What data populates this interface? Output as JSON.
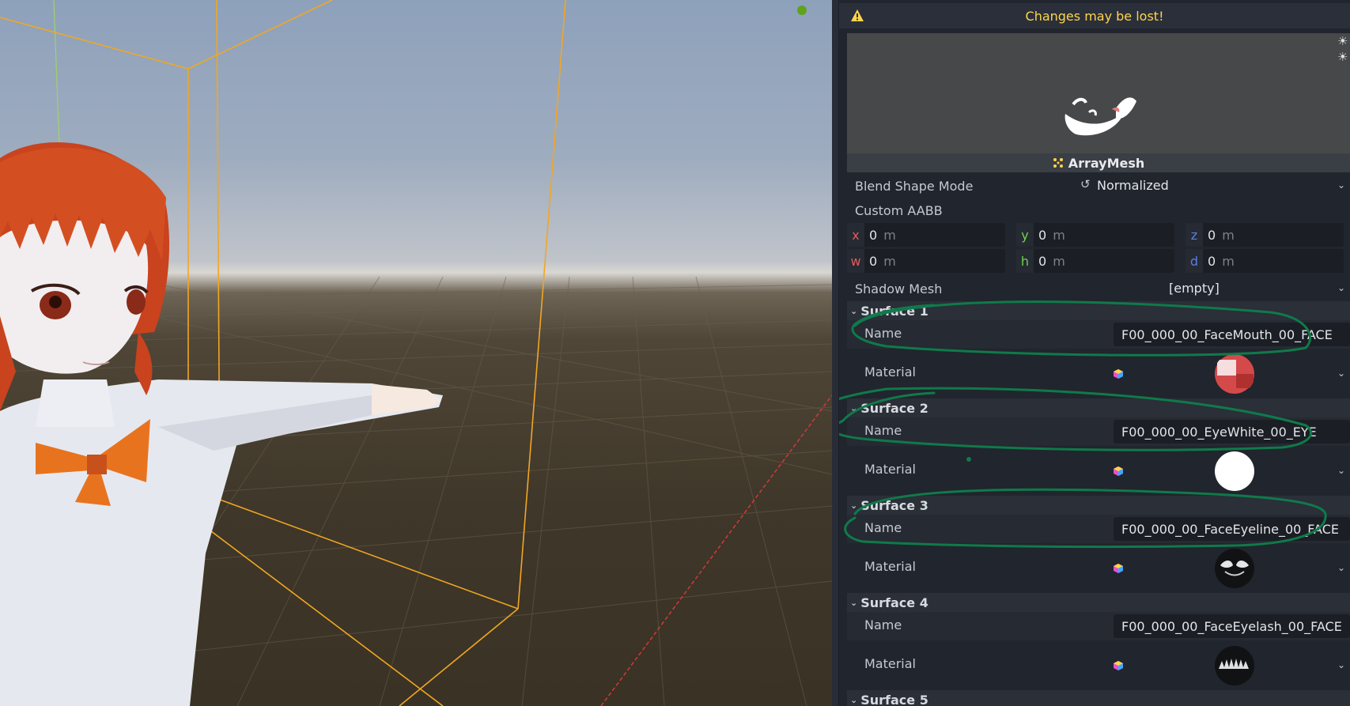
{
  "warning": {
    "text": "Changes may be lost!"
  },
  "mesh_resource": {
    "type_label": "ArrayMesh"
  },
  "properties": {
    "blend_shape_mode": {
      "label": "Blend Shape Mode",
      "value": "Normalized"
    },
    "custom_aabb": {
      "label": "Custom AABB",
      "fields": [
        {
          "axis": "x",
          "value": "0",
          "unit": "m",
          "color": "#e05c5c"
        },
        {
          "axis": "y",
          "value": "0",
          "unit": "m",
          "color": "#6fd14f"
        },
        {
          "axis": "z",
          "value": "0",
          "unit": "m",
          "color": "#5b7fe0"
        },
        {
          "axis": "w",
          "value": "0",
          "unit": "m",
          "color": "#e05c5c"
        },
        {
          "axis": "h",
          "value": "0",
          "unit": "m",
          "color": "#6fd14f"
        },
        {
          "axis": "d",
          "value": "0",
          "unit": "m",
          "color": "#5b7fe0"
        }
      ]
    },
    "shadow_mesh": {
      "label": "Shadow Mesh",
      "value": "[empty]"
    }
  },
  "surfaces": [
    {
      "title": "Surface 1",
      "name_label": "Name",
      "name": "F00_000_00_FaceMouth_00_FACE",
      "material_label": "Material",
      "material_icon": "material-icon"
    },
    {
      "title": "Surface 2",
      "name_label": "Name",
      "name": "F00_000_00_EyeWhite_00_EYE",
      "material_label": "Material",
      "material_icon": "material-icon"
    },
    {
      "title": "Surface 3",
      "name_label": "Name",
      "name": "F00_000_00_FaceEyeline_00_FACE",
      "material_label": "Material",
      "material_icon": "material-icon"
    },
    {
      "title": "Surface 4",
      "name_label": "Name",
      "name": "F00_000_00_FaceEyelash_00_FACE",
      "material_label": "Material",
      "material_icon": "material-icon"
    },
    {
      "title": "Surface 5"
    }
  ],
  "colors": {
    "warning_text": "#ffd54a",
    "annotation_stroke": "#0f7a4a",
    "selection_box": "#f2a623"
  }
}
